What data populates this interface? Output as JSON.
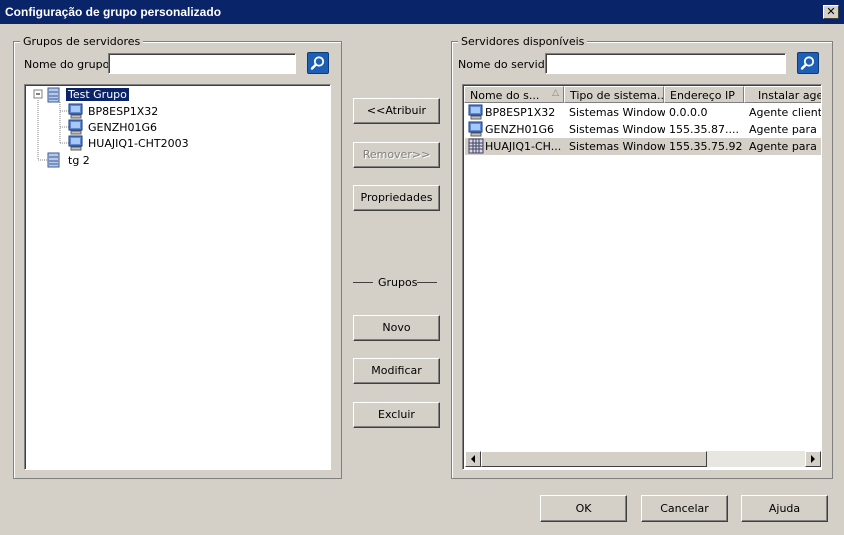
{
  "window": {
    "title": "Configuração de grupo personalizado",
    "close_glyph": "✕"
  },
  "left_group": {
    "legend": "Grupos de servidores",
    "name_label": "Nome do grupo:",
    "name_value": "",
    "tree": {
      "root": "Test Grupo",
      "children": [
        "BP8ESP1X32",
        "GENZH01G6",
        "HUAJIQ1-CHT2003"
      ],
      "second_group": "tg 2"
    }
  },
  "middle": {
    "assign": "<<Atribuir",
    "remove": "Remover>>",
    "properties": "Propriedades",
    "groups_label": "Grupos",
    "new": "Novo",
    "modify": "Modificar",
    "delete": "Excluir"
  },
  "right_group": {
    "legend": "Servidores disponíveis",
    "name_label": "Nome do servidor:",
    "name_value": "",
    "columns": [
      "Nome do s...",
      "Tipo de sistema...",
      "Endereço IP",
      "Instalar agen"
    ],
    "rows": [
      {
        "name": "BP8ESP1X32",
        "type": "Sistemas Windows",
        "ip": "0.0.0.0",
        "agent": "Agente cliente;"
      },
      {
        "name": "GENZH01G6",
        "type": "Sistemas Windows",
        "ip": "155.35.87....",
        "agent": "Agente para Mi"
      },
      {
        "name": "HUAJIQ1-CH...",
        "type": "Sistemas Windows",
        "ip": "155.35.75.92",
        "agent": "Agente para Mi"
      }
    ]
  },
  "footer": {
    "ok": "OK",
    "cancel": "Cancelar",
    "help": "Ajuda"
  },
  "colors": {
    "titlebar": "#0a246a",
    "face": "#d4d0c8",
    "selection": "#0a246a",
    "search_button": "#1c5fb5"
  }
}
